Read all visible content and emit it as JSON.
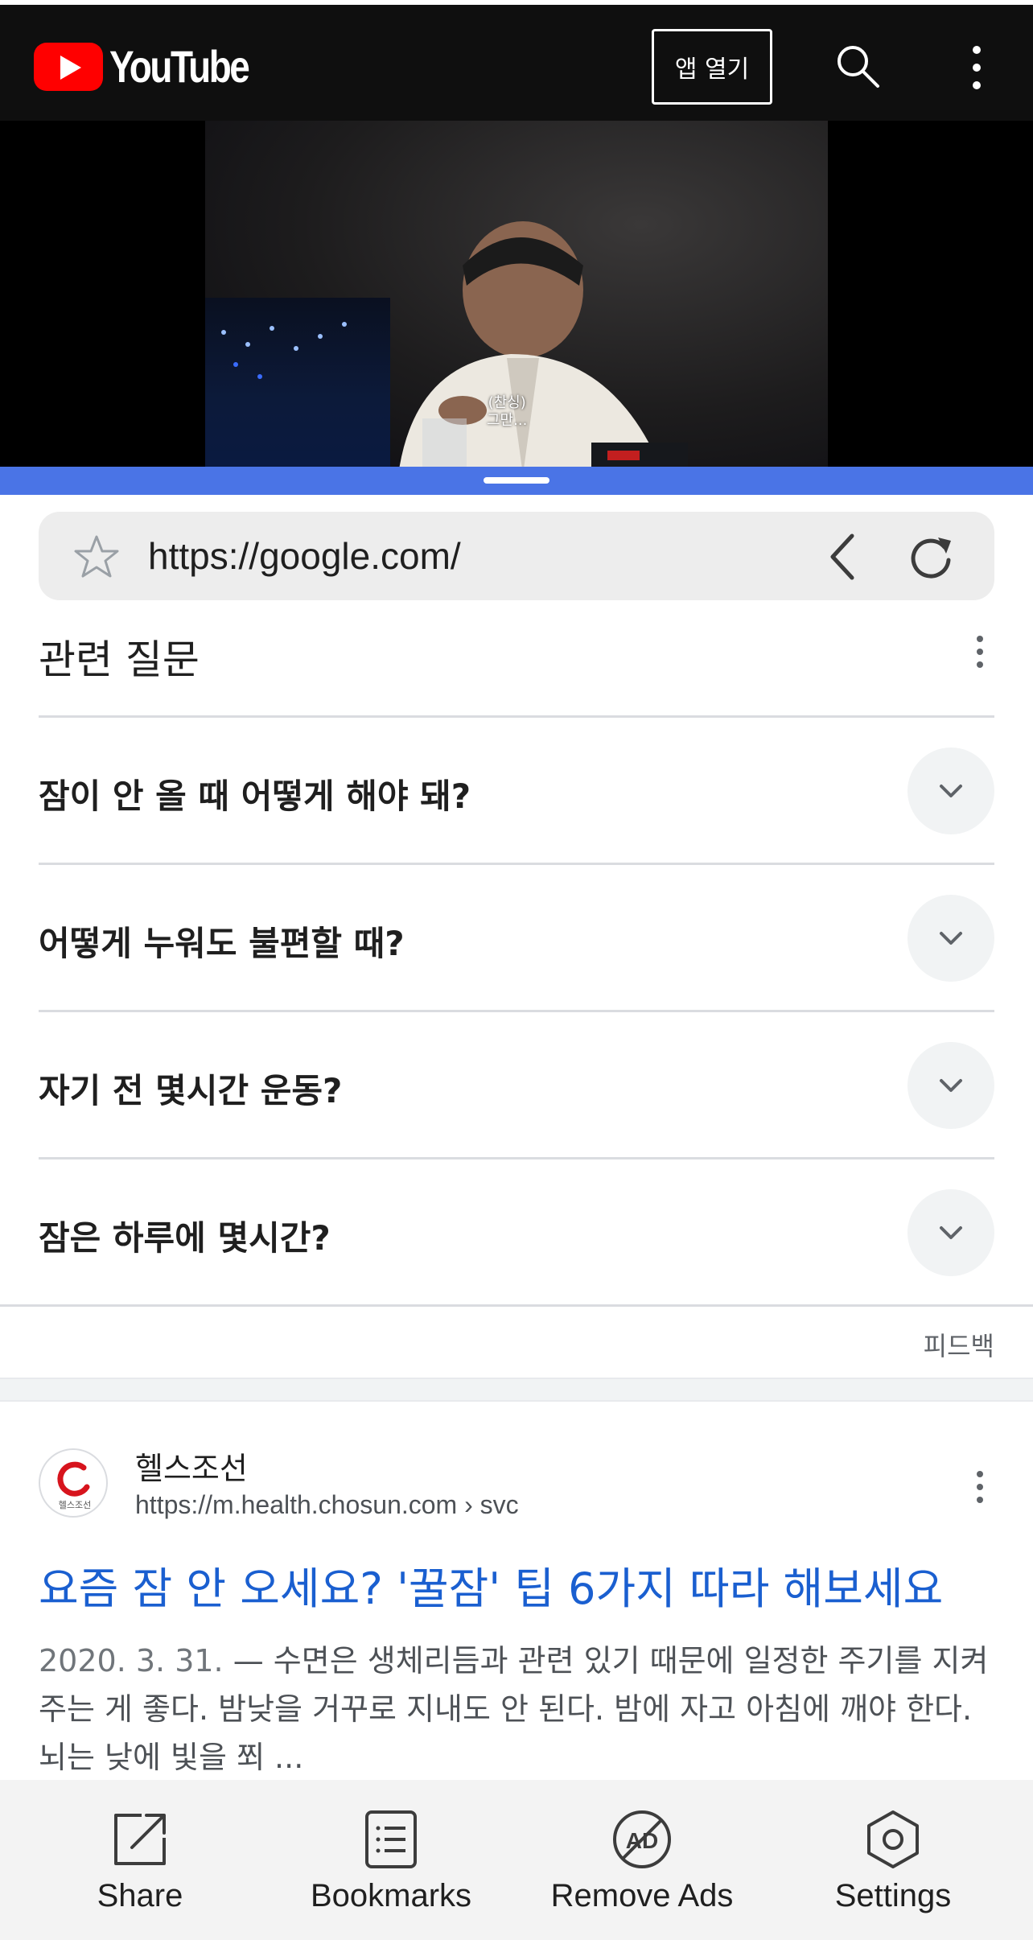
{
  "youtube_header": {
    "logo_text": "YouTube",
    "open_app_label": "앱 열기",
    "search_icon": "search-icon",
    "more_icon": "more-vert-icon",
    "brand_color": "#ff0000",
    "background_color": "#0f0f0f"
  },
  "video": {
    "caption_line1": "(찬싱)",
    "caption_line2": "그만...",
    "progress_color": "#4a74e6"
  },
  "url_bar": {
    "url": "https://google.com/",
    "star_icon": "star-icon",
    "back_icon": "chevron-left-icon",
    "reload_icon": "reload-icon"
  },
  "related_questions": {
    "title": "관련 질문",
    "items": [
      {
        "question": "잠이 안 올 때 어떻게 해야 돼?"
      },
      {
        "question": "어떻게 누워도 불편할 때?"
      },
      {
        "question": "자기 전 몇시간 운동?"
      },
      {
        "question": "잠은 하루에 몇시간?"
      }
    ],
    "feedback_label": "피드백"
  },
  "search_result": {
    "site_name": "헬스조선",
    "favicon_text": "헬스조선",
    "url": "https://m.health.chosun.com › svc",
    "title": "요즘 잠 안 오세요? '꿀잠' 팁 6가지 따라 해보세요",
    "date": "2020. 3. 31.",
    "snippet": " — 수면은 생체리듬과 관련 있기 때문에 일정한 주기를 지켜주는 게 좋다. 밤낮을 거꾸로 지내도 안 된다. 밤에 자고 아침에 깨야 한다. 뇌는 낮에 빛을 쬐 ...",
    "title_color": "#1a5fd0"
  },
  "bottom_bar": {
    "share_label": "Share",
    "bookmarks_label": "Bookmarks",
    "remove_ads_label": "Remove Ads",
    "settings_label": "Settings"
  }
}
